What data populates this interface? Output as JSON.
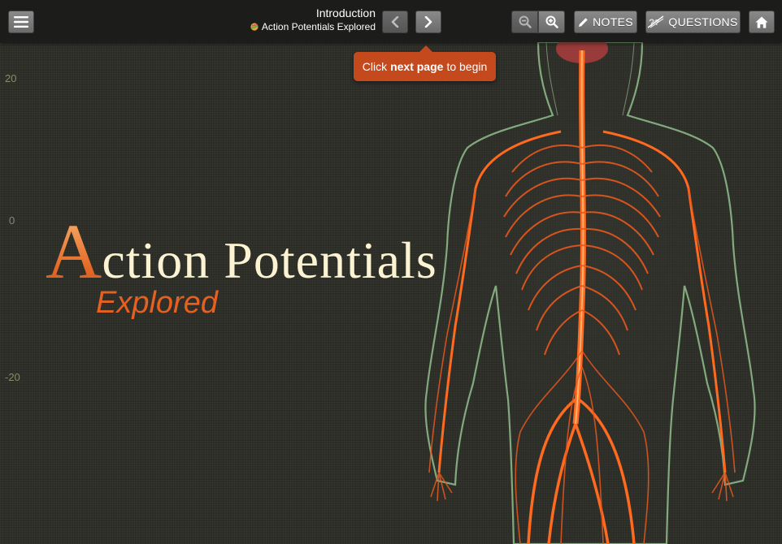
{
  "toolbar": {
    "section_title": "Introduction",
    "module_title": "Action Potentials Explored",
    "notes_label": "NOTES",
    "questions_label": "QUESTIONS",
    "icons": {
      "menu": "hamburger-menu-icon",
      "prev": "chevron-left-icon",
      "next": "chevron-right-icon",
      "zoom_out": "zoom-out-icon",
      "zoom_in": "zoom-in-icon",
      "notes": "pencil-icon",
      "questions": "questions-icon",
      "home": "home-icon"
    }
  },
  "tooltip": {
    "prefix": "Click",
    "bold": "next page",
    "suffix": "to begin",
    "color": "#c44a1e"
  },
  "axis": {
    "top": "20",
    "middle": "0",
    "bottom": "-20"
  },
  "hero": {
    "initial": "A",
    "title_rest": "ction Potentials",
    "subtitle": "Explored",
    "subtitle_color": "#e8601f"
  },
  "colors": {
    "background": "#2c2c27",
    "toolbar": "#1c1c1a",
    "nerve": "#e8581c",
    "body_outline": "#9fd39a"
  }
}
